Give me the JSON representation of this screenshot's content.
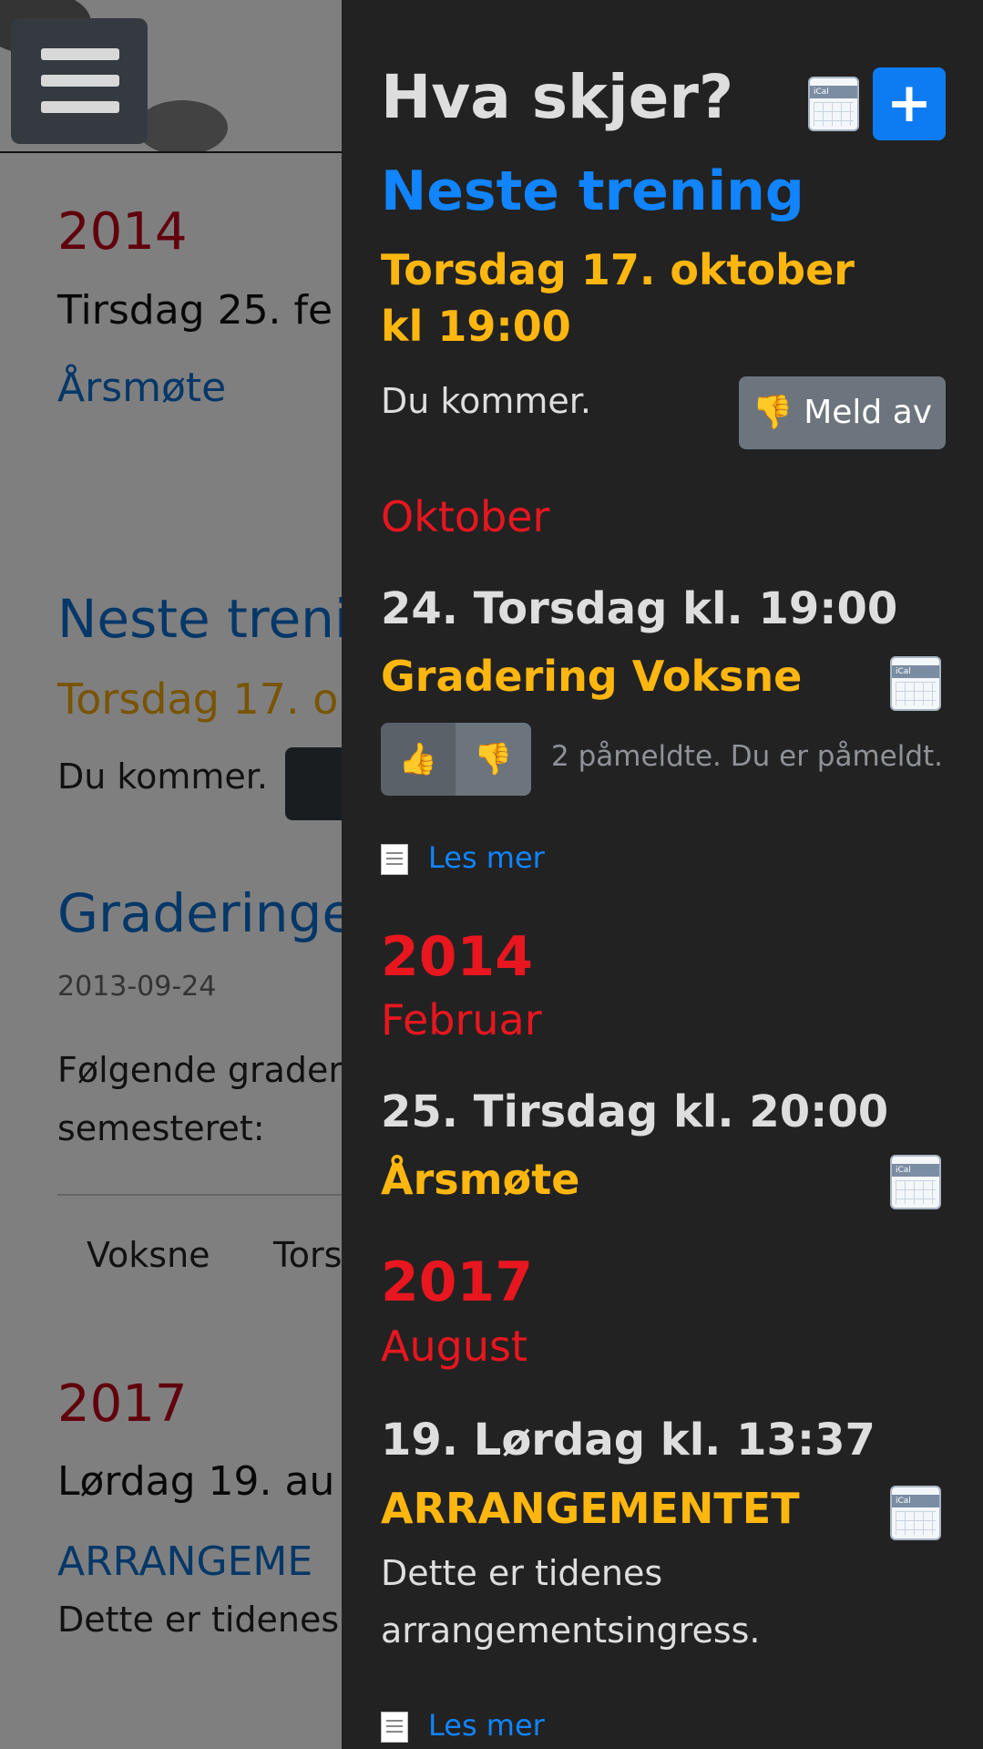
{
  "background": {
    "year1": "2014",
    "date1": "Tirsdag 25. fe",
    "link1": "Årsmøte",
    "next_heading": "Neste treni",
    "next_date": "Torsdag 17. ol",
    "you_come": "Du kommer.",
    "article_heading": "Graderinge",
    "article_date": "2013-09-24",
    "article_text1": "Følgende grader",
    "article_text2": "semesteret:",
    "table_col1": "Voksne",
    "table_col2": "Tors",
    "year2": "2017",
    "date2": "Lørdag 19. au",
    "link2": "ARRANGEME",
    "intro": "Dette er tidenes"
  },
  "panel": {
    "title": "Hva skjer?",
    "add_label": "+",
    "next_training": {
      "heading": "Neste trening",
      "date_line1": "Torsdag 17. oktober",
      "date_line2": "kl 19:00",
      "status": "Du kommer.",
      "unregister_label": "Meld av"
    },
    "groups": [
      {
        "month": "Oktober",
        "events": [
          {
            "date": "24. Torsdag kl. 19:00",
            "title": "Gradering Voksne",
            "signup_status": "2 påmeldte. Du er påmeldt.",
            "read_more": "Les mer"
          }
        ]
      },
      {
        "year": "2014",
        "month": "Februar",
        "events": [
          {
            "date": "25. Tirsdag kl. 20:00",
            "title": "Årsmøte"
          }
        ]
      },
      {
        "year": "2017",
        "month": "August",
        "events": [
          {
            "date": "19. Lørdag kl. 13:37",
            "title": "ARRANGEMENTET",
            "description": "Dette er tidenes arrangementsingress.",
            "read_more": "Les mer"
          }
        ]
      }
    ],
    "ical_label": "iCal"
  },
  "colors": {
    "panel_bg": "#222222",
    "accent_blue": "#1184ff",
    "accent_orange": "#ffb70f",
    "accent_red": "#e8161f"
  },
  "icons": [
    "menu-icon",
    "calendar-icon",
    "plus-icon",
    "thumbs-up-icon",
    "thumbs-down-icon",
    "document-icon"
  ]
}
